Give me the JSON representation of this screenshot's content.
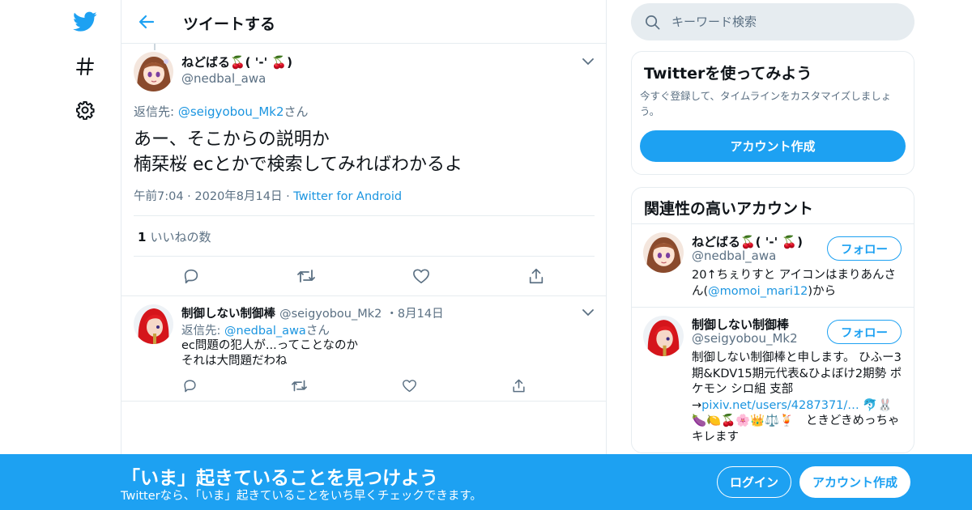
{
  "colors": {
    "accent": "#1da1f2",
    "link": "#1b95e0",
    "muted": "#5b7083",
    "border": "#e6ecf0"
  },
  "nav": {
    "icons": [
      "twitter-bird-icon",
      "hashtag-icon",
      "gear-icon"
    ]
  },
  "header": {
    "title": "ツイートする"
  },
  "tweet": {
    "display_name": "ねどばる🍒( '-' 🍒)",
    "handle": "@nedbal_awa",
    "reply_prefix": "返信先: ",
    "reply_to": "@seigyobou_Mk2",
    "reply_suffix": "さん",
    "text_line1": "あー、そこからの説明か",
    "text_line2": "楠栞桜 ecとかで検索してみればわかるよ",
    "time": "午前7:04",
    "date": "2020年8月14日",
    "source": "Twitter for Android",
    "likes_count": "1",
    "likes_label": "いいねの数",
    "dot": "·"
  },
  "reply": {
    "display_name": "制御しない制御棒",
    "handle": "@seigyobou_Mk2",
    "date": "・8月14日",
    "reply_prefix": "返信先: ",
    "reply_to": "@nedbal_awa",
    "reply_suffix": "さん",
    "text_line1": "ec問題の犯人が...ってことなのか",
    "text_line2": "それは大問題だわね"
  },
  "search": {
    "placeholder": "キーワード検索"
  },
  "signup_card": {
    "title": "Twitterを使ってみよう",
    "desc": "今すぐ登録して、タイムラインをカスタマイズしましょう。",
    "button": "アカウント作成"
  },
  "related": {
    "title": "関連性の高いアカウント",
    "accounts": [
      {
        "name": "ねどばる🍒( '-' 🍒)",
        "handle": "@nedbal_awa",
        "follow": "フォロー",
        "bio_pre": "20↑ちぇりすと アイコンはまりあんさん(",
        "bio_link": "@momoi_mari12",
        "bio_post": ")から"
      },
      {
        "name": "制御しない制御棒",
        "handle": "@seigyobou_Mk2",
        "follow": "フォロー",
        "bio_pre": "制御しない制御棒と申します。 ひふー3期&KDV15期元代表&ひよぼけ2期勢 ポケモン シロ組 支部→",
        "bio_link": "pixiv.net/users/4287371/…",
        "bio_post": " 🐬🐰🍆🍋🍒🌸👑⚖️🍹　ときどきめっちゃキレます"
      }
    ]
  },
  "banner": {
    "title": "「いま」起きていることを見つけよう",
    "subtitle": "Twitterなら、「いま」起きていることをいち早くチェックできます。",
    "login": "ログイン",
    "signup": "アカウント作成"
  }
}
